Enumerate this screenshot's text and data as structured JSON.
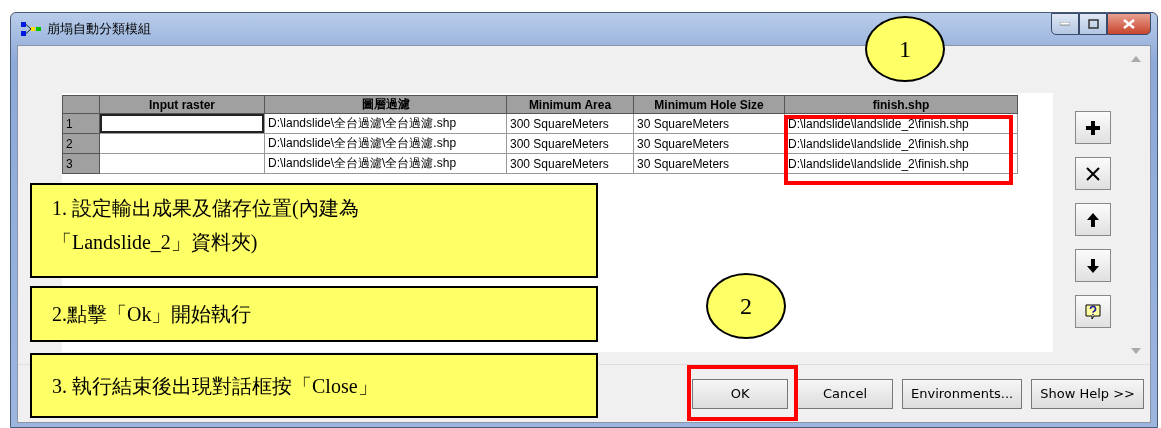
{
  "window": {
    "title": "崩塌自動分類模組"
  },
  "table": {
    "columns": [
      "Input raster",
      "圖層過濾",
      "Minimum Area",
      "Minimum Hole Size",
      "finish.shp"
    ],
    "rows": [
      {
        "number": "1",
        "selected": true,
        "cells": [
          "",
          "D:\\landslide\\全台過濾\\全台過濾.shp",
          "300 SquareMeters",
          "30 SquareMeters",
          "D:\\landslide\\landslide_2\\finish.shp"
        ]
      },
      {
        "number": "2",
        "selected": false,
        "cells": [
          "",
          "D:\\landslide\\全台過濾\\全台過濾.shp",
          "300 SquareMeters",
          "30 SquareMeters",
          "D:\\landslide\\landslide_2\\finish.shp"
        ]
      },
      {
        "number": "3",
        "selected": false,
        "cells": [
          "",
          "D:\\landslide\\全台過濾\\全台過濾.shp",
          "300 SquareMeters",
          "30 SquareMeters",
          "D:\\landslide\\landslide_2\\finish.shp"
        ]
      }
    ]
  },
  "side_buttons": [
    {
      "kind": "add"
    },
    {
      "kind": "delete"
    },
    {
      "kind": "up"
    },
    {
      "kind": "down"
    },
    {
      "kind": "help"
    }
  ],
  "buttons": [
    "OK",
    "Cancel",
    "Environments...",
    "Show Help >>"
  ],
  "annotations": {
    "notes": [
      "1.  設定輸出成果及儲存位置(內建為「Landslide_2」資料夾)",
      "2.點擊「Ok」開始執行",
      "3.  執行結束後出現對話框按「Close」"
    ],
    "markers": [
      "1",
      "2"
    ]
  }
}
